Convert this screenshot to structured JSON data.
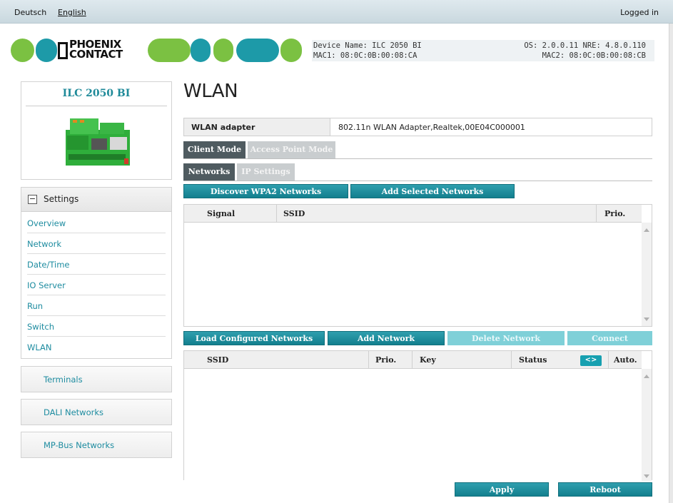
{
  "topbar": {
    "languages": [
      "Deutsch",
      "English"
    ],
    "login_status": "Logged in"
  },
  "logo": {
    "brand_line1": "PHOENIX",
    "brand_line2": "CONTACT"
  },
  "device_info": {
    "name": "Device Name: ILC 2050 BI",
    "mac1": "MAC1: 08:0C:0B:00:08:CA",
    "os": "OS: 2.0.0.11 NRE: 4.8.0.110",
    "mac2": "MAC2: 08:0C:0B:00:08:CB"
  },
  "sidebar": {
    "device_title": "ILC 2050 BI",
    "settings_label": "Settings",
    "items": [
      "Overview",
      "Network",
      "Date/Time",
      "IO Server",
      "Run",
      "Switch",
      "WLAN"
    ],
    "sections": [
      "Terminals",
      "DALI Networks",
      "MP-Bus Networks"
    ]
  },
  "main": {
    "title": "WLAN",
    "adapter_label": "WLAN adapter",
    "adapter_value": "802.11n WLAN Adapter,Realtek,00E04C000001",
    "mode_tabs": [
      "Client Mode",
      "Access Point Mode"
    ],
    "sub_tabs": [
      "Networks",
      "IP Settings"
    ],
    "discover_button": "Discover WPA2 Networks",
    "add_selected_button": "Add Selected Networks",
    "scan_table": {
      "columns": [
        "Signal",
        "SSID",
        "Prio."
      ]
    },
    "load_button": "Load Configured Networks",
    "add_network_button": "Add Network",
    "delete_network_button": "Delete Network",
    "connect_button": "Connect",
    "configured_table": {
      "columns": [
        "SSID",
        "Prio.",
        "Key",
        "Status",
        "Auto."
      ],
      "toggle_label": "<>"
    },
    "apply_button": "Apply",
    "reboot_button": "Reboot"
  },
  "colors": {
    "accent_teal": "#137f8e",
    "logo_green": "#7bc142",
    "logo_teal": "#1d9aa8",
    "link": "#1e8ca0"
  }
}
